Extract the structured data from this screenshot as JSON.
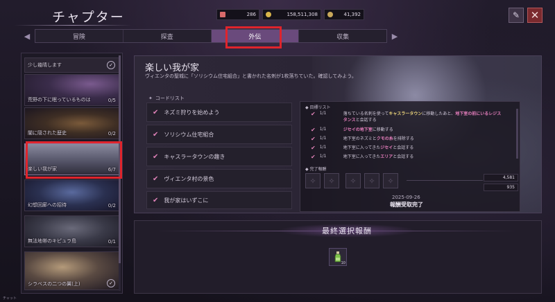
{
  "header": {
    "title": "チャプター",
    "currencies": [
      {
        "icon": "ticket-icon",
        "value": "286",
        "color": "#d86a6a"
      },
      {
        "icon": "gold-coin-icon",
        "value": "158,511,308",
        "color": "#d9b54a"
      },
      {
        "icon": "gem-icon",
        "value": "41,392",
        "color": "#c8a85a"
      }
    ]
  },
  "tabs": [
    {
      "label": "冒険",
      "active": false
    },
    {
      "label": "探査",
      "active": false
    },
    {
      "label": "外伝",
      "active": true
    },
    {
      "label": "収集",
      "active": false
    }
  ],
  "sidebar": {
    "items": [
      {
        "label": "少し幾晴します",
        "count": "",
        "checked": true
      },
      {
        "label": "荒野の下に眠っているものは",
        "count": "0/5",
        "checked": false
      },
      {
        "label": "闇に隠された歴史",
        "count": "0/2",
        "checked": false
      },
      {
        "label": "楽しい我が家",
        "count": "6/7",
        "checked": false,
        "selected": true
      },
      {
        "label": "幻想回廊への招待",
        "count": "0/2",
        "checked": false
      },
      {
        "label": "無法地帯のキピュラ島",
        "count": "0/1",
        "checked": false
      },
      {
        "label": "シラベスの二つの翼(上)",
        "count": "",
        "checked": true
      }
    ]
  },
  "quest": {
    "title": "楽しい我が家",
    "description": "ヴィエンタの聖城に「ソリシウム住宅組合」と書かれた名刺が1枚落ちていた。確認してみよう。",
    "code_list_label": "コードリスト",
    "code_items": [
      "ネズミ狩りを始めよう",
      "ソリシウム住宅組合",
      "キャスラータウンの趣き",
      "ヴィエンタ村の景色",
      "我が家はいずこに"
    ]
  },
  "targets": {
    "label": "目標リスト",
    "rows": [
      {
        "fraction": "1/1",
        "parts": [
          {
            "t": "落ちている名刺を使って",
            "s": ""
          },
          {
            "t": "キャスラータウン",
            "s": "y"
          },
          {
            "t": "に移動したあと、",
            "s": ""
          },
          {
            "t": "地下室の前にいるレジスタンス",
            "s": "p"
          },
          {
            "t": "と会話する",
            "s": ""
          }
        ]
      },
      {
        "fraction": "1/1",
        "parts": [
          {
            "t": "ジセイの地下室",
            "s": "p"
          },
          {
            "t": "に移動する",
            "s": ""
          }
        ]
      },
      {
        "fraction": "1/1",
        "parts": [
          {
            "t": "地下室のネズミと",
            "s": ""
          },
          {
            "t": "クモの糸",
            "s": "p"
          },
          {
            "t": "を排除する",
            "s": ""
          }
        ]
      },
      {
        "fraction": "1/1",
        "parts": [
          {
            "t": "地下室に入ってきた",
            "s": ""
          },
          {
            "t": "ジセイ",
            "s": "p"
          },
          {
            "t": "と会話する",
            "s": ""
          }
        ]
      },
      {
        "fraction": "1/1",
        "parts": [
          {
            "t": "地下室に入ってきた",
            "s": ""
          },
          {
            "t": "エリア",
            "s": "p"
          },
          {
            "t": "と会話する",
            "s": ""
          }
        ]
      }
    ]
  },
  "completion": {
    "label": "完了報酬",
    "amounts": [
      "4,581",
      "935"
    ],
    "date": "2025-09-26",
    "status": "報酬受取完了"
  },
  "final_reward": {
    "label": "最終選択報酬",
    "item_icon": "potion-bottle-icon",
    "quantity": "10"
  },
  "footer": {
    "text": "チャット"
  }
}
